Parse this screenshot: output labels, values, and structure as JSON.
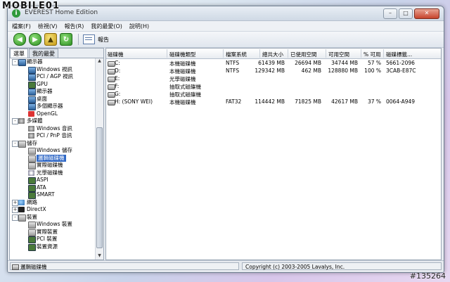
{
  "watermark": {
    "brand": "MOBILE01",
    "id": "#135264"
  },
  "window": {
    "title": "EVEREST Home Edition"
  },
  "menu": [
    "檔案(F)",
    "檢視(V)",
    "報告(R)",
    "我的最愛(O)",
    "說明(H)"
  ],
  "toolbar": {
    "report_label": "報告"
  },
  "tabs": {
    "menu": "選單",
    "favorites": "我的最愛"
  },
  "tree": [
    {
      "label": "顯示器",
      "level": 0,
      "exp": "-",
      "icon": "monitor"
    },
    {
      "label": "Windows 視訊",
      "level": 1,
      "icon": "monitor"
    },
    {
      "label": "PCI / AGP 視訊",
      "level": 1,
      "icon": "monitor"
    },
    {
      "label": "GPU",
      "level": 1,
      "icon": "chip"
    },
    {
      "label": "顯示器",
      "level": 1,
      "icon": "monitor"
    },
    {
      "label": "桌面",
      "level": 1,
      "icon": "monitor"
    },
    {
      "label": "多個顯示器",
      "level": 1,
      "icon": "monitor"
    },
    {
      "label": "OpenGL",
      "level": 1,
      "icon": "opengl"
    },
    {
      "label": "多媒體",
      "level": 0,
      "exp": "-",
      "icon": "sound"
    },
    {
      "label": "Windows 音訊",
      "level": 1,
      "icon": "sound"
    },
    {
      "label": "PCI / PnP 音訊",
      "level": 1,
      "icon": "sound"
    },
    {
      "label": "儲存",
      "level": 0,
      "exp": "-",
      "icon": "drive"
    },
    {
      "label": "Windows 儲存",
      "level": 1,
      "icon": "drive"
    },
    {
      "label": "邏輯磁碟機",
      "level": 1,
      "icon": "drive",
      "selected": true
    },
    {
      "label": "實際磁碟機",
      "level": 1,
      "icon": "drive"
    },
    {
      "label": "光學磁碟機",
      "level": 1,
      "icon": "disc"
    },
    {
      "label": "ASPI",
      "level": 1,
      "icon": "chip"
    },
    {
      "label": "ATA",
      "level": 1,
      "icon": "chip"
    },
    {
      "label": "SMART",
      "level": 1,
      "icon": "chip"
    },
    {
      "label": "網路",
      "level": 0,
      "exp": "+",
      "icon": "net"
    },
    {
      "label": "DirectX",
      "level": 0,
      "exp": "+",
      "icon": "x"
    },
    {
      "label": "裝置",
      "level": 0,
      "exp": "-",
      "icon": "drive"
    },
    {
      "label": "Windows 裝置",
      "level": 1,
      "icon": "drive"
    },
    {
      "label": "實際裝置",
      "level": 1,
      "icon": "drive"
    },
    {
      "label": "PCI 裝置",
      "level": 1,
      "icon": "chip"
    },
    {
      "label": "裝置資源",
      "level": 1,
      "icon": "chip"
    }
  ],
  "table": {
    "headers": [
      "磁碟機",
      "磁碟機類型",
      "檔案系統",
      "總共大小",
      "已使用空間",
      "可用空間",
      "% 可用",
      "磁碟標籤..."
    ],
    "rows": [
      [
        "C:",
        "本機磁碟機",
        "NTFS",
        "61439 MB",
        "26694 MB",
        "34744 MB",
        "57 %",
        "5661-2096"
      ],
      [
        "D:",
        "本機磁碟機",
        "NTFS",
        "129342 MB",
        "462 MB",
        "128880 MB",
        "100 %",
        "3CAB-E87C"
      ],
      [
        "E:",
        "光學磁碟機",
        "",
        "",
        "",
        "",
        "",
        ""
      ],
      [
        "F:",
        "抽取式磁碟機",
        "",
        "",
        "",
        "",
        "",
        ""
      ],
      [
        "G:",
        "抽取式磁碟機",
        "",
        "",
        "",
        "",
        "",
        ""
      ],
      [
        "H: (SONY WEI)",
        "本機磁碟機",
        "FAT32",
        "114442 MB",
        "71825 MB",
        "42617 MB",
        "37 %",
        "0064-A949"
      ]
    ]
  },
  "status": {
    "left": "邏輯磁碟機",
    "right": "Copyright (c) 2003-2005 Lavalys, Inc."
  }
}
